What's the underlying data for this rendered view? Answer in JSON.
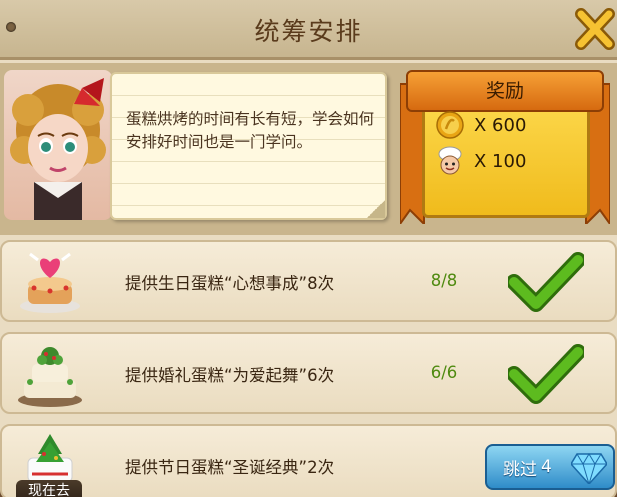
{
  "header": {
    "title": "统筹安排"
  },
  "dialogue": {
    "text": "蛋糕烘烤的时间有长有短，学会如何安排好时间也是一门学问。"
  },
  "reward": {
    "title": "奖励",
    "items": [
      {
        "icon": "gold-coin-icon",
        "amount": "X 600"
      },
      {
        "icon": "chef-head-icon",
        "amount": "X 100"
      }
    ]
  },
  "tasks": [
    {
      "label": "提供生日蛋糕“心想事成”8次",
      "progress": "8/8",
      "status": "complete"
    },
    {
      "label": "提供婚礼蛋糕“为爱起舞”6次",
      "progress": "6/6",
      "status": "complete"
    },
    {
      "label": "提供节日蛋糕“圣诞经典”2次",
      "skip_label": "跳过",
      "skip_cost": "4",
      "go_label": "现在去"
    }
  ],
  "colors": {
    "title_text": "#5a3b1c",
    "reward_ribbon": "#e98420",
    "reward_box": "#f6c930",
    "progress_text": "#4f8a10",
    "check_green": "#4aa316",
    "skip_button": "#3a98d2"
  }
}
